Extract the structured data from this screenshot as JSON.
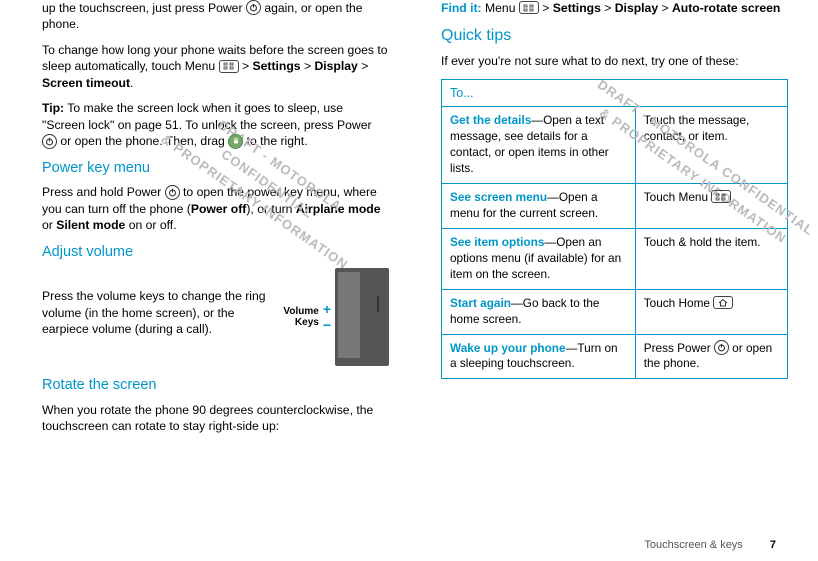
{
  "left": {
    "p1a": "up the touchscreen, just press Power ",
    "p1b": " again, or open the phone.",
    "p2a": "To change how long your phone waits before the screen goes to sleep automatically, touch Menu ",
    "p2b": " > ",
    "p2_settings": "Settings",
    "p2c": " > ",
    "p2_display": "Display",
    "p2d": " > ",
    "p2_timeout": "Screen timeout",
    "p2e": ".",
    "tip_label": "Tip:",
    "p3a": " To make the screen lock when it goes to sleep, use \"Screen lock\" on page 51. To unlock the screen, press Power ",
    "p3b": " or open the phone. Then, drag ",
    "p3c": " to the right.",
    "h_power": "Power key menu",
    "p4a": "Press and hold Power ",
    "p4b": " to open the power key menu, where you can turn off the phone (",
    "p4_poweroff": "Power off",
    "p4c": "), or turn ",
    "p4_airplane": "Airplane mode",
    "p4d": " or ",
    "p4_silent": "Silent mode",
    "p4e": " on or off.",
    "h_vol": "Adjust volume",
    "p5": "Press the volume keys to change the ring volume (in the home screen), or the earpiece volume (during a call).",
    "vol_label1": "Volume",
    "vol_label2": "Keys",
    "h_rotate": "Rotate the screen",
    "p6": "When you rotate the phone 90 degrees counterclockwise, the touchscreen can rotate to stay right-side up:"
  },
  "right": {
    "find_label": "Find it:",
    "find_a": " Menu ",
    "find_b": " > ",
    "find_settings": "Settings",
    "find_c": " > ",
    "find_display": "Display",
    "find_d": " > ",
    "find_auto": "Auto-rotate screen",
    "h_tips": "Quick tips",
    "p_tips": "If ever you're not sure what to do next, try one of these:",
    "th_to": "To...",
    "rows": {
      "r1": {
        "key": "Get the details",
        "desc": "—Open a text message, see details for a contact, or open items in other lists.",
        "act": "Touch the message, contact, or item."
      },
      "r2": {
        "key": "See screen menu",
        "desc": "—Open a menu for the current screen.",
        "act_a": "Touch Menu "
      },
      "r3": {
        "key": "See item options",
        "desc": "—Open an options menu (if available) for an item on the screen.",
        "act": "Touch & hold the item."
      },
      "r4": {
        "key": "Start again",
        "desc": "—Go back to the home screen.",
        "act_a": "Touch Home "
      },
      "r5": {
        "key": "Wake up your phone",
        "desc": "—Turn on a sleeping touchscreen.",
        "act_a": "Press Power ",
        "act_b": " or open the phone."
      }
    }
  },
  "footer": {
    "section": "Touchscreen & keys",
    "page": "7"
  },
  "watermark": {
    "w1l1": "DRAFT - MOTOROLA CONFIDENTIAL",
    "w1l2": "& PROPRIETARY INFORMATION"
  }
}
